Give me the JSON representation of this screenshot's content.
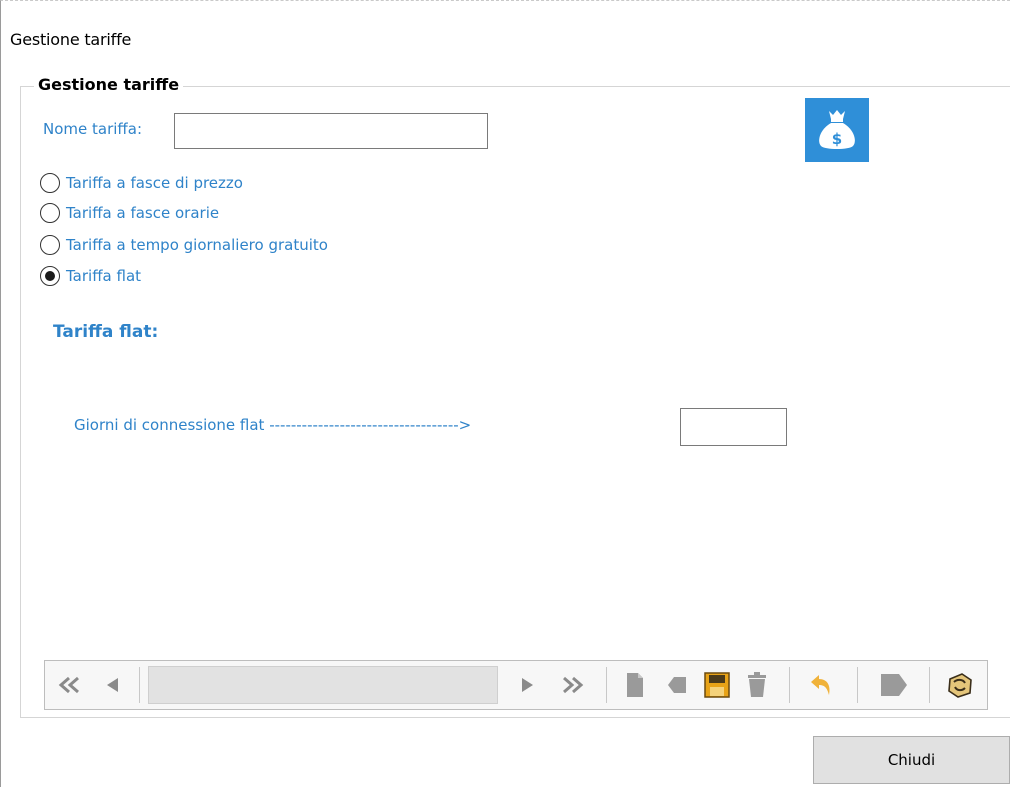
{
  "window": {
    "title": "Gestione tariffe"
  },
  "group": {
    "legend": "Gestione tariffe"
  },
  "form": {
    "nome_label": "Nome tariffa:",
    "nome_value": ""
  },
  "radios": [
    {
      "label": "Tariffa a fasce di prezzo",
      "checked": false
    },
    {
      "label": "Tariffa a fasce orarie",
      "checked": false
    },
    {
      "label": "Tariffa a tempo giornaliero gratuito",
      "checked": false
    },
    {
      "label": "Tariffa flat",
      "checked": true
    }
  ],
  "flat": {
    "section_title": "Tariffa flat:",
    "giorni_label": "Giorni di connessione flat ----------------------------------->",
    "giorni_value": ""
  },
  "navigator": {
    "icons": [
      "first-record-icon",
      "previous-record-icon",
      "next-record-icon",
      "last-record-icon",
      "new-record-icon",
      "edit-record-icon",
      "save-icon",
      "delete-icon",
      "undo-icon",
      "cancel-icon",
      "refresh-icon"
    ]
  },
  "footer": {
    "close_label": "Chiudi"
  },
  "colors": {
    "accent": "#2f83c9",
    "tile": "#2f8fd8",
    "save": "#e8a317"
  }
}
